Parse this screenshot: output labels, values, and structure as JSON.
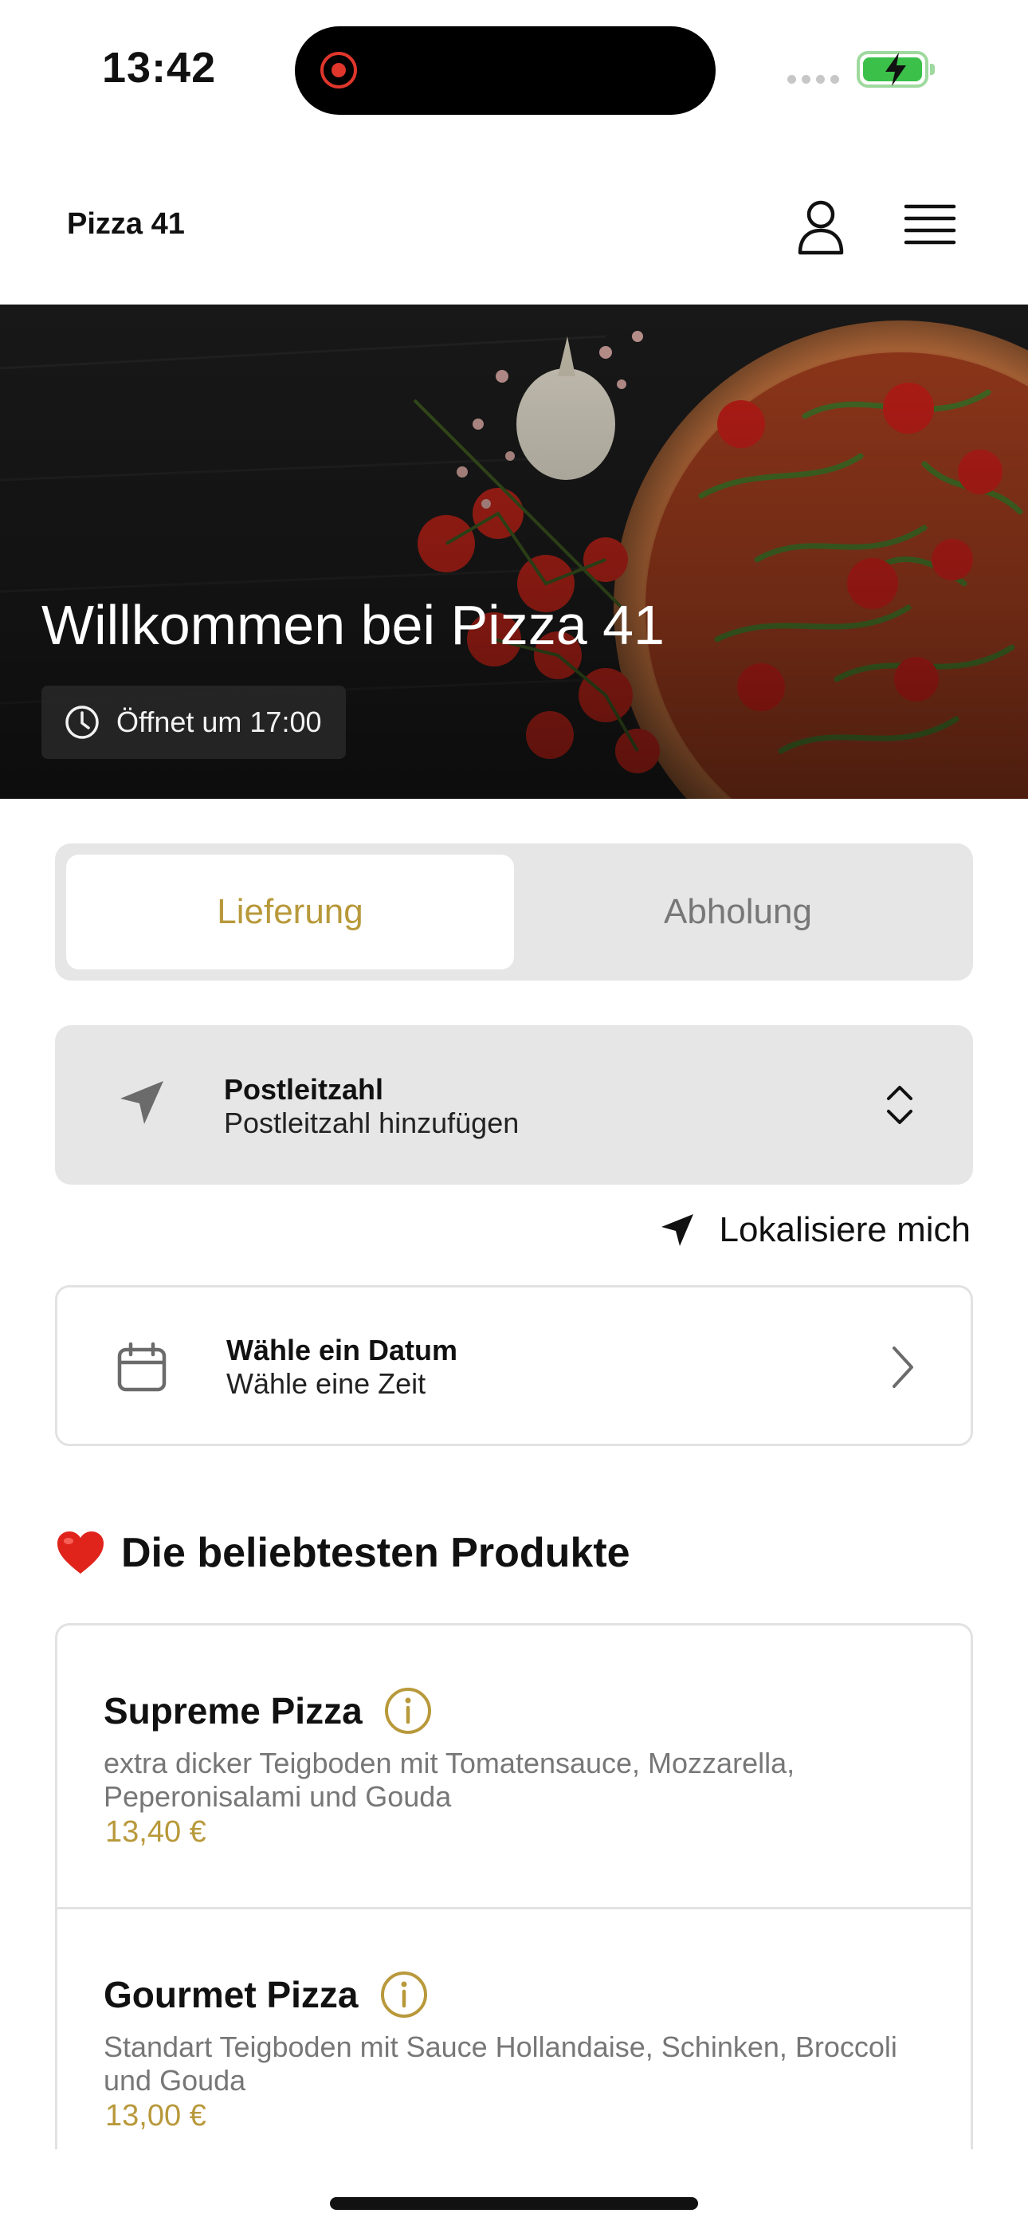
{
  "status_bar": {
    "time": "13:42"
  },
  "header": {
    "brand": "Pizza 41",
    "icons": [
      "user-icon",
      "menu-icon"
    ]
  },
  "hero": {
    "title": "Willkommen bei Pizza 41",
    "opening": "Öffnet um 17:00",
    "icons": [
      "clock-icon"
    ]
  },
  "order_mode": {
    "options": [
      "Lieferung",
      "Abholung"
    ],
    "selected": "Lieferung"
  },
  "postal": {
    "title": "Postleitzahl",
    "subtitle": "Postleitzahl hinzufügen",
    "icons": [
      "location-arrow-icon",
      "up-down-chevron-icon"
    ]
  },
  "locate_me": {
    "label": "Lokalisiere mich",
    "icon": "location-arrow-icon"
  },
  "date": {
    "title": "Wähle ein Datum",
    "subtitle": "Wähle eine Zeit",
    "icons": [
      "calendar-icon",
      "chevron-right-icon"
    ]
  },
  "popular": {
    "icon": "heart-icon",
    "title": "Die beliebtesten Produkte",
    "products": [
      {
        "name": "Supreme Pizza",
        "description": "extra dicker Teigboden mit Tomatensauce, Mozzarella, Peperonisalami und Gouda",
        "price": "13,40 €"
      },
      {
        "name": "Gourmet Pizza",
        "description": "Standart Teigboden mit Sauce Hollandaise, Schinken, Broccoli und Gouda",
        "price": "13,00 €"
      }
    ]
  },
  "colors": {
    "accent": "#b8993b",
    "card_grey": "#e6e6e6",
    "recording": "#e0362c",
    "battery": "#3bc14a"
  }
}
